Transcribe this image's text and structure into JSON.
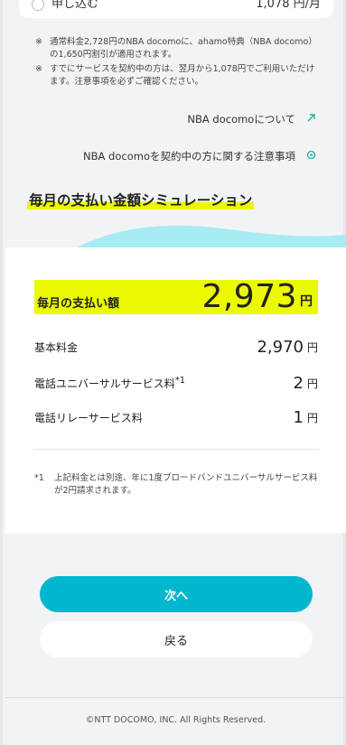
{
  "top_option": {
    "label": "申し込む",
    "price": "1,078 円/月"
  },
  "notes": [
    {
      "mark": "※",
      "text": "通常料金2,728円のNBA docomoに、ahamo特典（NBA docomo）の1,650円割引が適用されます。"
    },
    {
      "mark": "※",
      "text": "すでにサービスを契約中の方は、翌月から1,078円でご利用いただけます。注意事項を必ずご確認ください。"
    }
  ],
  "links": {
    "about": "NBA docomoについて",
    "notice": "NBA docomoを契約中の方に関する注意事項"
  },
  "simulation": {
    "title": "毎月の支払い金額シミュレーション",
    "total_label": "毎月の支払い額",
    "total_amount": "2,973",
    "yen": "円",
    "rows": [
      {
        "label": "基本料金",
        "sup": "",
        "amount": "2,970",
        "yen": "円"
      },
      {
        "label": "電話ユニバーサルサービス料",
        "sup": "*1",
        "amount": "2",
        "yen": "円"
      },
      {
        "label": "電話リレーサービス料",
        "sup": "",
        "amount": "1",
        "yen": "円"
      }
    ],
    "footnote_mark": "*1",
    "footnote_text": "上記料金とは別途、年に1度ブロードバンドユニバーサルサービス料が2円請求されます。"
  },
  "buttons": {
    "next": "次へ",
    "back": "戻る"
  },
  "footer": {
    "copyright": "©NTT DOCOMO, INC. All Rights Reserved."
  },
  "colors": {
    "accent": "#00b7ce",
    "highlight": "#ecfa00",
    "link_icon": "#18b5a0",
    "wave": "#a7ecf3"
  },
  "icons": {
    "about_link": "external-arrow-icon",
    "notice_link": "circle-link-icon"
  }
}
